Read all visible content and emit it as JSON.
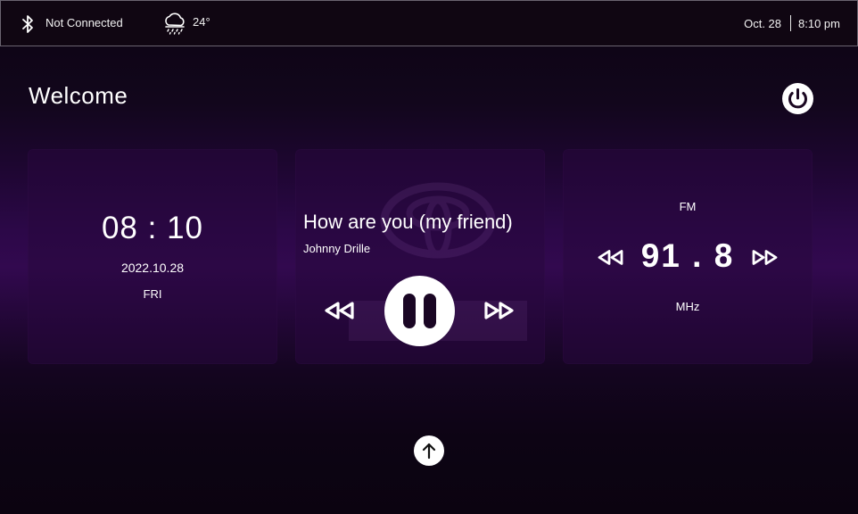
{
  "status_bar": {
    "bluetooth_icon": "bluetooth-icon",
    "bluetooth_status": "Not Connected",
    "weather_icon": "cloud-rain-icon",
    "temperature": "24°",
    "date": "Oct. 28",
    "time": "8:10 pm"
  },
  "home": {
    "welcome": "Welcome",
    "power_icon": "power-icon",
    "up_icon": "arrow-up-icon"
  },
  "clock_card": {
    "time": "08 : 10",
    "date": "2022.10.28",
    "day": "FRI"
  },
  "music_card": {
    "title": "How are you (my friend)",
    "artist": "Johnny Drille",
    "prev_icon": "rewind-icon",
    "play_state_icon": "pause-icon",
    "next_icon": "fast-forward-icon"
  },
  "radio_card": {
    "band": "FM",
    "frequency": "91 . 8",
    "unit": "MHz",
    "prev_icon": "rewind-icon",
    "next_icon": "fast-forward-icon"
  },
  "colors": {
    "accent": "#32094f",
    "background": "#0c0412",
    "text": "#ffffff"
  }
}
